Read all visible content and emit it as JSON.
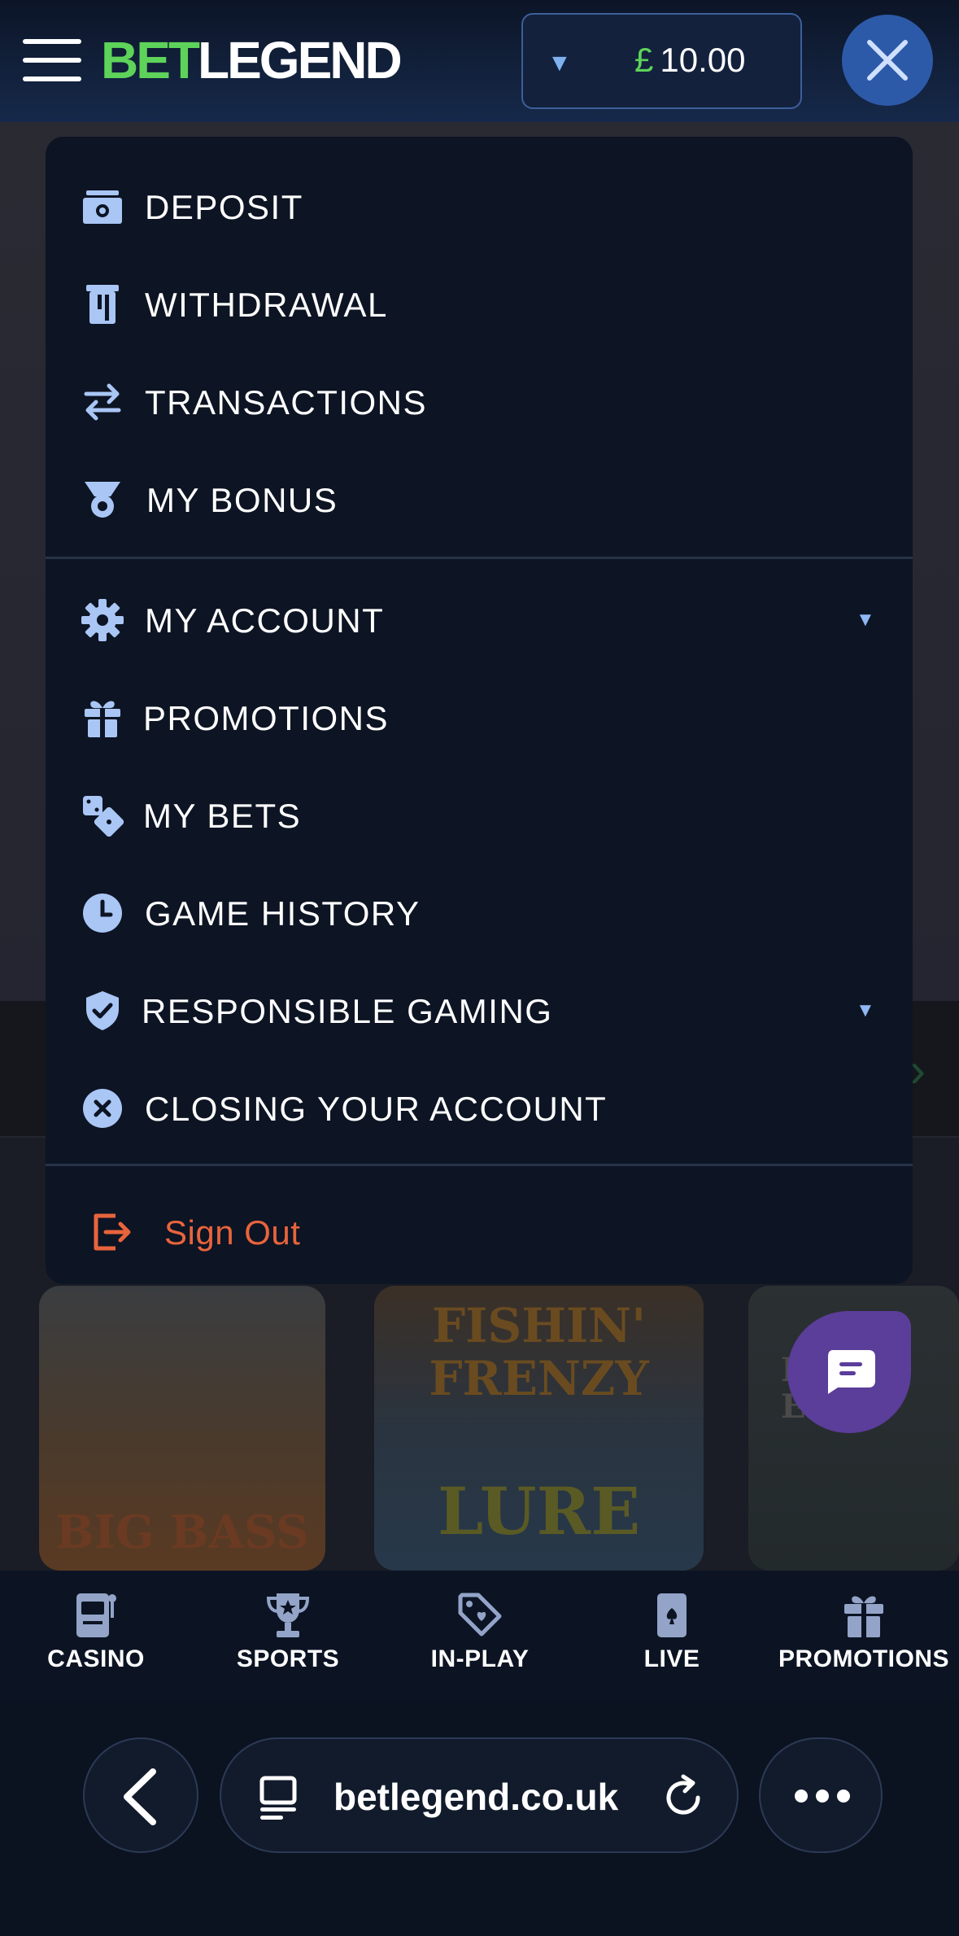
{
  "header": {
    "logo_bet": "BET",
    "logo_legend": "LEGEND",
    "balance_currency": "£",
    "balance_amount": "10.00"
  },
  "menu": {
    "section1": [
      {
        "label": "DEPOSIT",
        "icon": "deposit-icon"
      },
      {
        "label": "WITHDRAWAL",
        "icon": "withdrawal-icon"
      },
      {
        "label": "TRANSACTIONS",
        "icon": "transactions-icon"
      },
      {
        "label": "MY BONUS",
        "icon": "medal-icon"
      }
    ],
    "section2": [
      {
        "label": "MY ACCOUNT",
        "icon": "gear-icon",
        "expandable": true
      },
      {
        "label": "PROMOTIONS",
        "icon": "gift-icon"
      },
      {
        "label": "MY BETS",
        "icon": "dice-icon"
      },
      {
        "label": "GAME HISTORY",
        "icon": "clock-icon"
      },
      {
        "label": "RESPONSIBLE GAMING",
        "icon": "shield-check-icon",
        "expandable": true
      },
      {
        "label": "CLOSING YOUR ACCOUNT",
        "icon": "close-circle-icon"
      }
    ],
    "sign_out": "Sign Out"
  },
  "background_tiles": {
    "tile1_text": "BIG BASS",
    "tile2_text_a": "FISHIN'",
    "tile2_text_b": "FRENZY",
    "tile2_text_c": "LURE",
    "tile3_text_a": "RK",
    "tile3_text_b": "ERS"
  },
  "bottom_nav": [
    {
      "label": "CASINO",
      "icon": "slot-machine-icon"
    },
    {
      "label": "SPORTS",
      "icon": "trophy-icon"
    },
    {
      "label": "IN-PLAY",
      "icon": "tag-icon"
    },
    {
      "label": "LIVE",
      "icon": "playing-card-icon"
    },
    {
      "label": "PROMOTIONS",
      "icon": "gift-icon"
    }
  ],
  "browser": {
    "url": "betlegend.co.uk"
  },
  "colors": {
    "accent_green": "#5ed35a",
    "accent_blue": "#2d5aa8",
    "sign_out": "#e8643c",
    "icon_blue": "#a9c6f5",
    "chat_purple": "#5b3d9a"
  }
}
